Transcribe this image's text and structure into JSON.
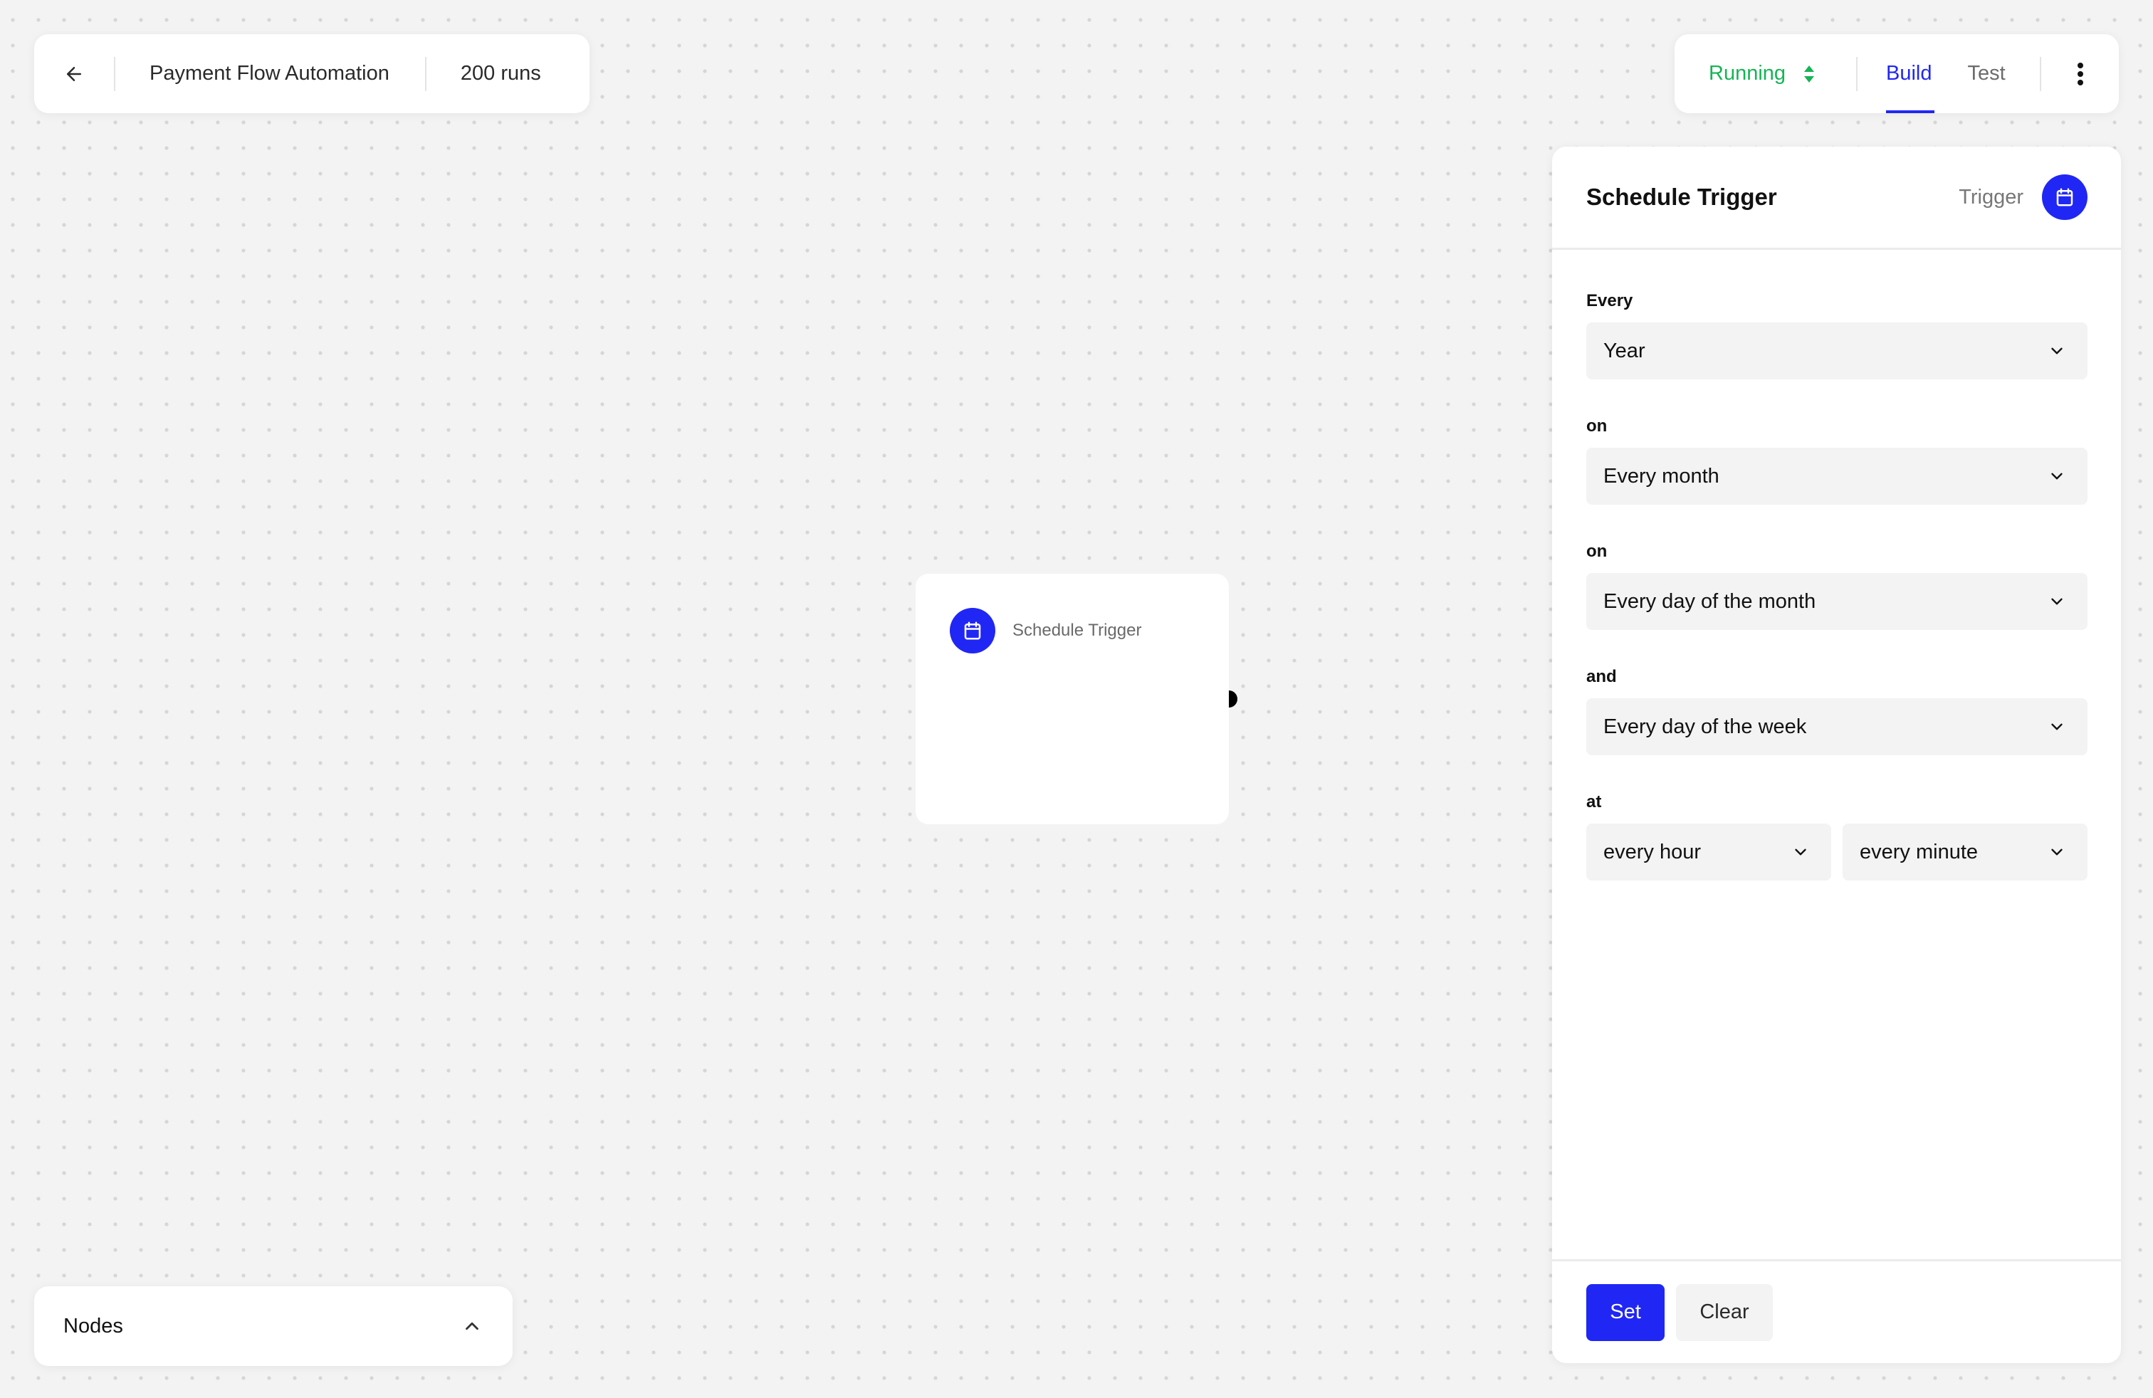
{
  "header": {
    "back_icon": "arrow-left-icon",
    "title": "Payment Flow Automation",
    "runs": "200 runs"
  },
  "toolbar": {
    "status": "Running",
    "status_color": "#16b455",
    "status_icon": "sort-updown-icon",
    "tabs": [
      {
        "label": "Build",
        "active": true
      },
      {
        "label": "Test",
        "active": false
      }
    ],
    "more_icon": "more-vertical-icon",
    "accent": "#2027f4"
  },
  "canvas": {
    "node": {
      "label": "Schedule Trigger",
      "icon": "calendar-icon"
    }
  },
  "nodes_panel": {
    "label": "Nodes",
    "toggle_icon": "chevron-up-icon"
  },
  "config": {
    "title": "Schedule Trigger",
    "type": "Trigger",
    "icon": "calendar-icon",
    "fields": [
      {
        "label": "Every",
        "value": "Year"
      },
      {
        "label": "on",
        "value": "Every month"
      },
      {
        "label": "on",
        "value": "Every day of the month"
      },
      {
        "label": "and",
        "value": "Every day of the week"
      },
      {
        "label": "at",
        "values": [
          "every hour",
          "every minute"
        ]
      }
    ],
    "buttons": {
      "set": "Set",
      "clear": "Clear"
    }
  }
}
